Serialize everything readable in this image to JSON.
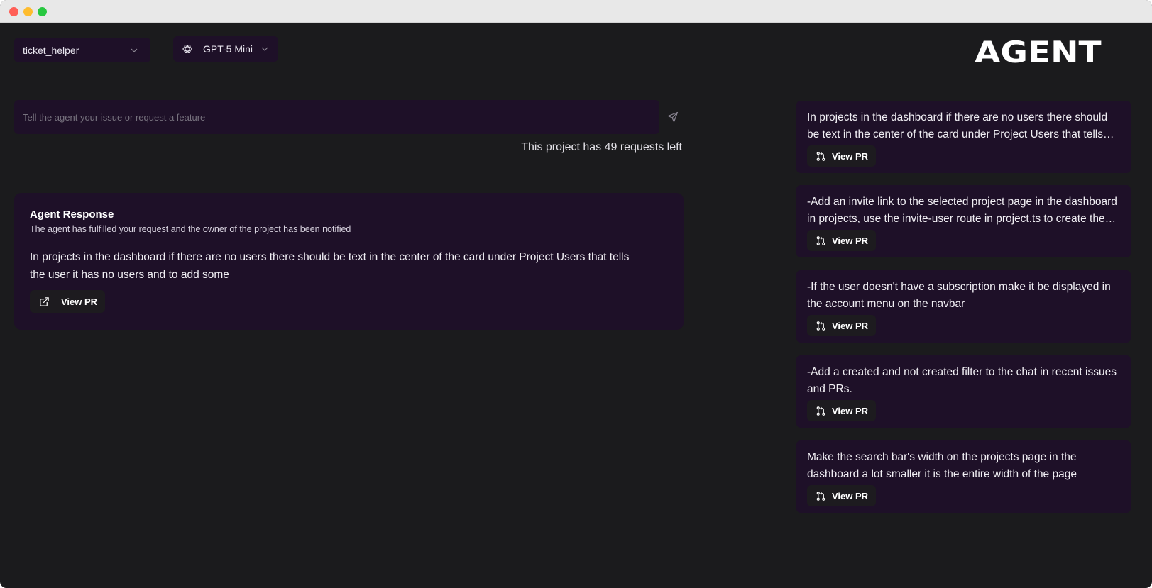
{
  "header": {
    "agent_select": "ticket_helper",
    "model_select": "GPT-5 Mini",
    "logo_text": "AGENT"
  },
  "prompt": {
    "placeholder": "Tell the agent your issue or request a feature",
    "requests_left": "This project has 49 requests left"
  },
  "response": {
    "title": "Agent Response",
    "subtitle": "The agent has fulfilled your request and the owner of the project has been notified",
    "body": "In projects in the dashboard if there are no users there should be text in the center of the card under Project Users that tells the user it has no users and to add some",
    "button_label": "View PR"
  },
  "history": [
    {
      "text": "In projects in the dashboard if there are no users there should be text in the center of the card under Project Users that tells the user it has no users and to add some",
      "button_label": "View PR"
    },
    {
      "text": "-Add an invite link to the selected project page in the dashboard in projects, use the invite-user route in project.ts to create the link",
      "button_label": "View PR"
    },
    {
      "text": "-If the user doesn't have a subscription make it be displayed in the account menu on the navbar",
      "button_label": "View PR"
    },
    {
      "text": "-Add a created and not created filter to the chat in recent issues and PRs.",
      "button_label": "View PR"
    },
    {
      "text": "Make the search bar's width on the projects page in the dashboard a lot smaller it is the entire width of the page",
      "button_label": "View PR"
    }
  ],
  "colors": {
    "background": "#1b1b1d",
    "panel": "#1e1028",
    "button": "#1d1b1f",
    "text": "#f1eff4"
  }
}
